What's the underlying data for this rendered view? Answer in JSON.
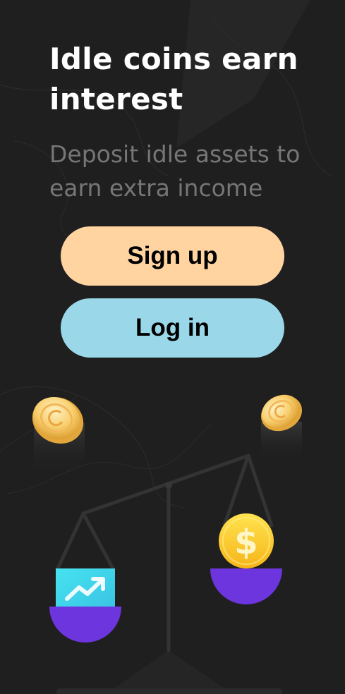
{
  "hero": {
    "title": "Idle coins earn interest",
    "subtitle": "Deposit idle assets to earn extra income"
  },
  "actions": {
    "signup_label": "Sign up",
    "login_label": "Log in"
  },
  "illustration": {
    "dollar_symbol": "$",
    "icons": [
      "coin-icon",
      "coin-icon",
      "trend-up-icon",
      "dollar-coin-icon",
      "balance-scale-icon"
    ]
  },
  "colors": {
    "background": "#1f1f1f",
    "signup_button": "#ffd4a1",
    "login_button": "#9ad8e9",
    "scale_pan": "#6d35de",
    "coin_gold": "#f6c35c",
    "trend_card": "#3fd6e8"
  }
}
